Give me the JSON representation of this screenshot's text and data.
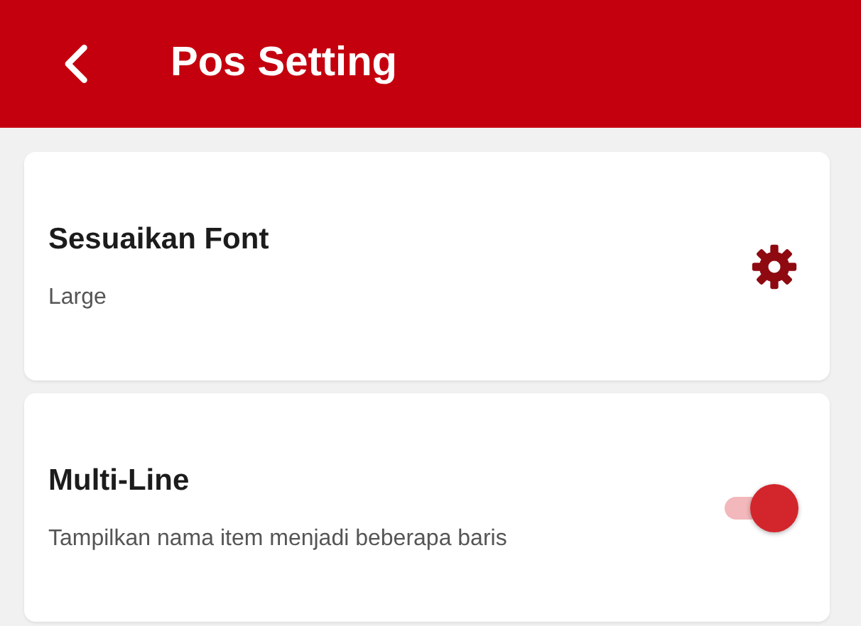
{
  "app_bar": {
    "title": "Pos Setting"
  },
  "settings": [
    {
      "kind": "gear",
      "title": "Sesuaikan Font",
      "subtitle": "Large"
    },
    {
      "kind": "toggle",
      "title": "Multi-Line",
      "subtitle": "Tampilkan nama item menjadi beberapa baris",
      "on": true
    }
  ]
}
